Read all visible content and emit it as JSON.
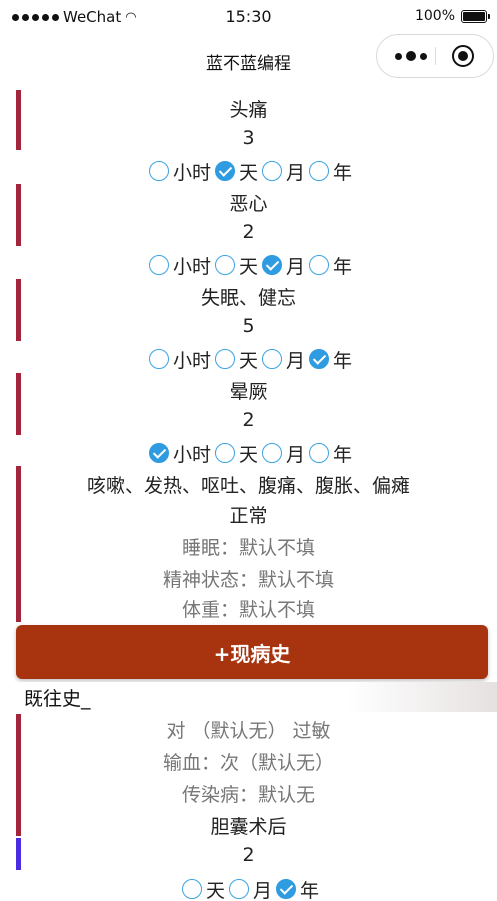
{
  "status_bar": {
    "carrier": "WeChat",
    "time": "15:30",
    "battery": "100%"
  },
  "nav": {
    "title": "蓝不蓝编程"
  },
  "top_cut_text": "...",
  "symptoms": [
    {
      "name": "头痛",
      "duration": "3",
      "units": [
        "小时",
        "天",
        "月",
        "年"
      ],
      "selected": "天"
    },
    {
      "name": "恶心",
      "duration": "2",
      "units": [
        "小时",
        "天",
        "月",
        "年"
      ],
      "selected": "月"
    },
    {
      "name": "失眠、健忘",
      "duration": "5",
      "units": [
        "小时",
        "天",
        "月",
        "年"
      ],
      "selected": "年"
    },
    {
      "name": "晕厥",
      "duration": "2",
      "units": [
        "小时",
        "天",
        "月",
        "年"
      ],
      "selected": "小时"
    }
  ],
  "other_symptoms": "咳嗽、发热、呕吐、腹痛、腹胀、偏瘫",
  "general_status": "正常",
  "sleep": "睡眠：默认不填",
  "mental": "精神状态：默认不填",
  "weight": "体重：默认不填",
  "add_present_illness": "+现病史",
  "past_history": {
    "heading": "既往史_",
    "allergy": "对 （默认无） 过敏",
    "transfusion": "输血：次（默认无）",
    "infectious": "传染病：默认无",
    "surgery": "胆囊术后",
    "surgery_duration": "2",
    "surgery_units": [
      "天",
      "月",
      "年"
    ],
    "surgery_selected": "年"
  },
  "colors": {
    "accent_red": "#a3253b",
    "button": "#a8330f",
    "radio": "#2f9be0",
    "bar_blue": "#4a2de0",
    "bar_green": "#1a8a1a"
  }
}
